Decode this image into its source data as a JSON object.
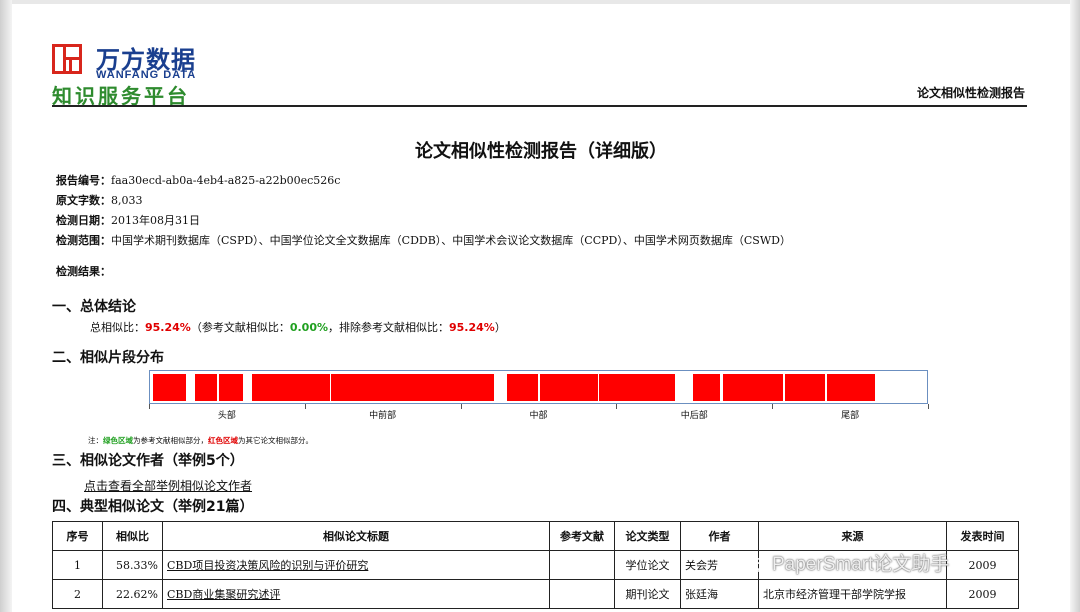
{
  "logo": {
    "brand_cn": "万方数据",
    "brand_en": "WANFANG DATA",
    "platform": "知识服务平台"
  },
  "header_right": "论文相似性检测报告",
  "title": "论文相似性检测报告（详细版）",
  "meta": {
    "report_no_label": "报告编号：",
    "report_no": "faa30ecd-ab0a-4eb4-a825-a22b00ec526c",
    "word_count_label": "原文字数：",
    "word_count": "8,033",
    "date_label": "检测日期：",
    "date": "2013年08月31日",
    "scope_label": "检测范围：",
    "scope": "中国学术期刊数据库（CSPD）、中国学位论文全文数据库（CDDB）、中国学术会议论文数据库（CCPD）、中国学术网页数据库（CSWD）",
    "result_label": "检测结果："
  },
  "section1": {
    "heading": "一、总体结论",
    "total_label": "总相似比：",
    "total": "95.24%",
    "ref_label": "（参考文献相似比：",
    "ref": "0.00%",
    "excl_label": "，排除参考文献相似比：",
    "excl": "95.24%",
    "close": "）"
  },
  "section2": {
    "heading": "二、相似片段分布",
    "axis_labels": [
      "头部",
      "中前部",
      "中部",
      "中后部",
      "尾部"
    ],
    "segments": [
      {
        "start": 0.0,
        "end": 0.043
      },
      {
        "start": 0.055,
        "end": 0.083
      },
      {
        "start": 0.085,
        "end": 0.117
      },
      {
        "start": 0.128,
        "end": 0.229
      },
      {
        "start": 0.231,
        "end": 0.442
      },
      {
        "start": 0.459,
        "end": 0.5
      },
      {
        "start": 0.502,
        "end": 0.577
      },
      {
        "start": 0.579,
        "end": 0.677
      },
      {
        "start": 0.701,
        "end": 0.736
      },
      {
        "start": 0.739,
        "end": 0.817
      },
      {
        "start": 0.82,
        "end": 0.871
      },
      {
        "start": 0.874,
        "end": 0.936
      }
    ],
    "note_prefix": "注：",
    "note_green": "绿色区域",
    "note_mid": "为参考文献相似部分，",
    "note_red": "红色区域",
    "note_end": "为其它论文相似部分。",
    "fill_color": "#ff0000"
  },
  "section3": {
    "heading": "三、相似论文作者（举例5个）",
    "link": "点击查看全部举例相似论文作者"
  },
  "section4": {
    "heading": "四、典型相似论文（举例21篇）",
    "columns": [
      "序号",
      "相似比",
      "相似论文标题",
      "参考文献",
      "论文类型",
      "作者",
      "来源",
      "发表时间"
    ],
    "rows": [
      [
        "1",
        "58.33%",
        "CBD项目投资决策风险的识别与评价研究",
        "",
        "学位论文",
        "关会芳",
        "",
        "2009"
      ],
      [
        "2",
        "22.62%",
        "CBD商业集聚研究述评",
        "",
        "期刊论文",
        "张廷海",
        "北京市经济管理干部学院学报",
        "2009"
      ]
    ]
  },
  "watermark": "PaperSmart论文助手"
}
